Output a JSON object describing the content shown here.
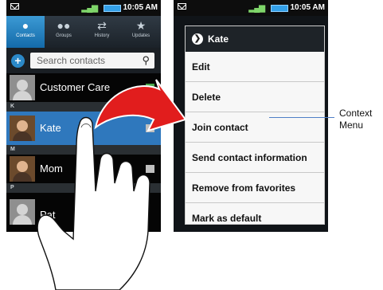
{
  "status_bar": {
    "time": "10:05 AM"
  },
  "tabs": [
    {
      "label": "Contacts",
      "icon": "person-icon"
    },
    {
      "label": "Groups",
      "icon": "group-icon"
    },
    {
      "label": "History",
      "icon": "history-icon"
    },
    {
      "label": "Updates",
      "icon": "updates-icon"
    }
  ],
  "search": {
    "placeholder": "Search contacts"
  },
  "contacts": [
    {
      "name": "Customer Care"
    },
    {
      "name": "Kate"
    },
    {
      "name": "Mom"
    },
    {
      "name": "Pat"
    }
  ],
  "section_headers": {
    "k": "K",
    "m": "M",
    "p": "P"
  },
  "context_menu": {
    "title": "Kate",
    "items": [
      "Edit",
      "Delete",
      "Join contact",
      "Send contact information",
      "Remove from favorites",
      "Mark as default"
    ]
  },
  "callout": {
    "line1": "Context",
    "line2": "Menu"
  },
  "colors": {
    "accent": "#2f78bd",
    "arrow_red": "#e11d1d"
  }
}
